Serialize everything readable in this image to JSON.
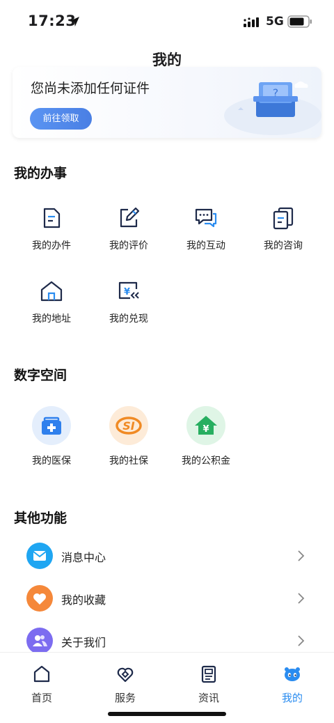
{
  "status_bar": {
    "time": "17:23",
    "network": "5G"
  },
  "header": {
    "title": "我的"
  },
  "id_card": {
    "message": "您尚未添加任何证件",
    "button_label": "前往领取"
  },
  "affairs": {
    "title": "我的办事",
    "items": [
      {
        "label": "我的办件",
        "icon": "document-icon"
      },
      {
        "label": "我的评价",
        "icon": "edit-icon"
      },
      {
        "label": "我的互动",
        "icon": "chat-icon"
      },
      {
        "label": "我的咨询",
        "icon": "copy-icon"
      },
      {
        "label": "我的地址",
        "icon": "house-icon"
      },
      {
        "label": "我的兑现",
        "icon": "yuan-exchange-icon"
      }
    ]
  },
  "digital_space": {
    "title": "数字空间",
    "items": [
      {
        "label": "我的医保",
        "icon": "medical-kit-icon",
        "color": "#2f80ed"
      },
      {
        "label": "我的社保",
        "icon": "social-security-icon",
        "color": "#f08a24"
      },
      {
        "label": "我的公积金",
        "icon": "housing-fund-icon",
        "color": "#27ae60"
      }
    ]
  },
  "other": {
    "title": "其他功能",
    "items": [
      {
        "label": "消息中心",
        "icon": "mail-icon",
        "color": "#1fa6f2"
      },
      {
        "label": "我的收藏",
        "icon": "heart-icon",
        "color": "#f5883a"
      },
      {
        "label": "关于我们",
        "icon": "people-icon",
        "color": "#7c6cf0"
      }
    ]
  },
  "tab_bar": {
    "tabs": [
      {
        "label": "首页",
        "icon": "home-icon"
      },
      {
        "label": "服务",
        "icon": "service-icon"
      },
      {
        "label": "资讯",
        "icon": "news-icon"
      },
      {
        "label": "我的",
        "icon": "mascot-icon",
        "active": true
      }
    ]
  },
  "colors": {
    "accent": "#2a8cf0",
    "button": "#4a7fe4"
  }
}
